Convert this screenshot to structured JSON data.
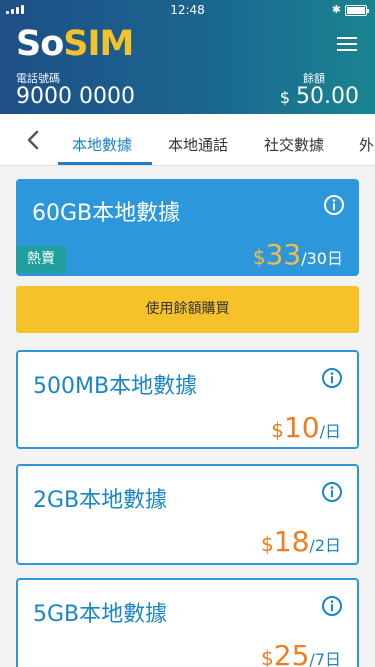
{
  "status_bar": {
    "time": "12:48",
    "bluetooth_icon": "bluetooth-icon",
    "battery_icon": "battery-icon"
  },
  "header": {
    "logo_so": "So",
    "logo_sim": "SIM",
    "phone_label": "電話號碼",
    "phone_number": "9000 0000",
    "balance_label": "餘額",
    "balance_currency": "$",
    "balance_amount": "50.00",
    "menu_icon": "hamburger-menu-icon",
    "colors": {
      "header_start": "#1e4f86",
      "header_end": "#1a8490",
      "logo_accent": "#f5c229"
    }
  },
  "tabs": {
    "back_icon": "chevron-left-icon",
    "items": [
      {
        "label": "本地數據",
        "active": true
      },
      {
        "label": "本地通話",
        "active": false
      },
      {
        "label": "社交數據",
        "active": false
      },
      {
        "label": "外",
        "active": false
      }
    ]
  },
  "plans": [
    {
      "name": "60GB本地數據",
      "currency": "$",
      "price": "33",
      "unit": "/30日",
      "badge": "熱賣",
      "featured": true
    },
    {
      "name": "500MB本地數據",
      "currency": "$",
      "price": "10",
      "unit": "/日",
      "featured": false
    },
    {
      "name": "2GB本地數據",
      "currency": "$",
      "price": "18",
      "unit": "/2日",
      "featured": false
    },
    {
      "name": "5GB本地數據",
      "currency": "$",
      "price": "25",
      "unit": "/7日",
      "featured": false
    }
  ],
  "buy_button_label": "使用餘額購買",
  "colors": {
    "primary": "#2d97db",
    "accent": "#f5c229",
    "price_orange": "#ef7d22",
    "badge": "#1f9f9d"
  }
}
